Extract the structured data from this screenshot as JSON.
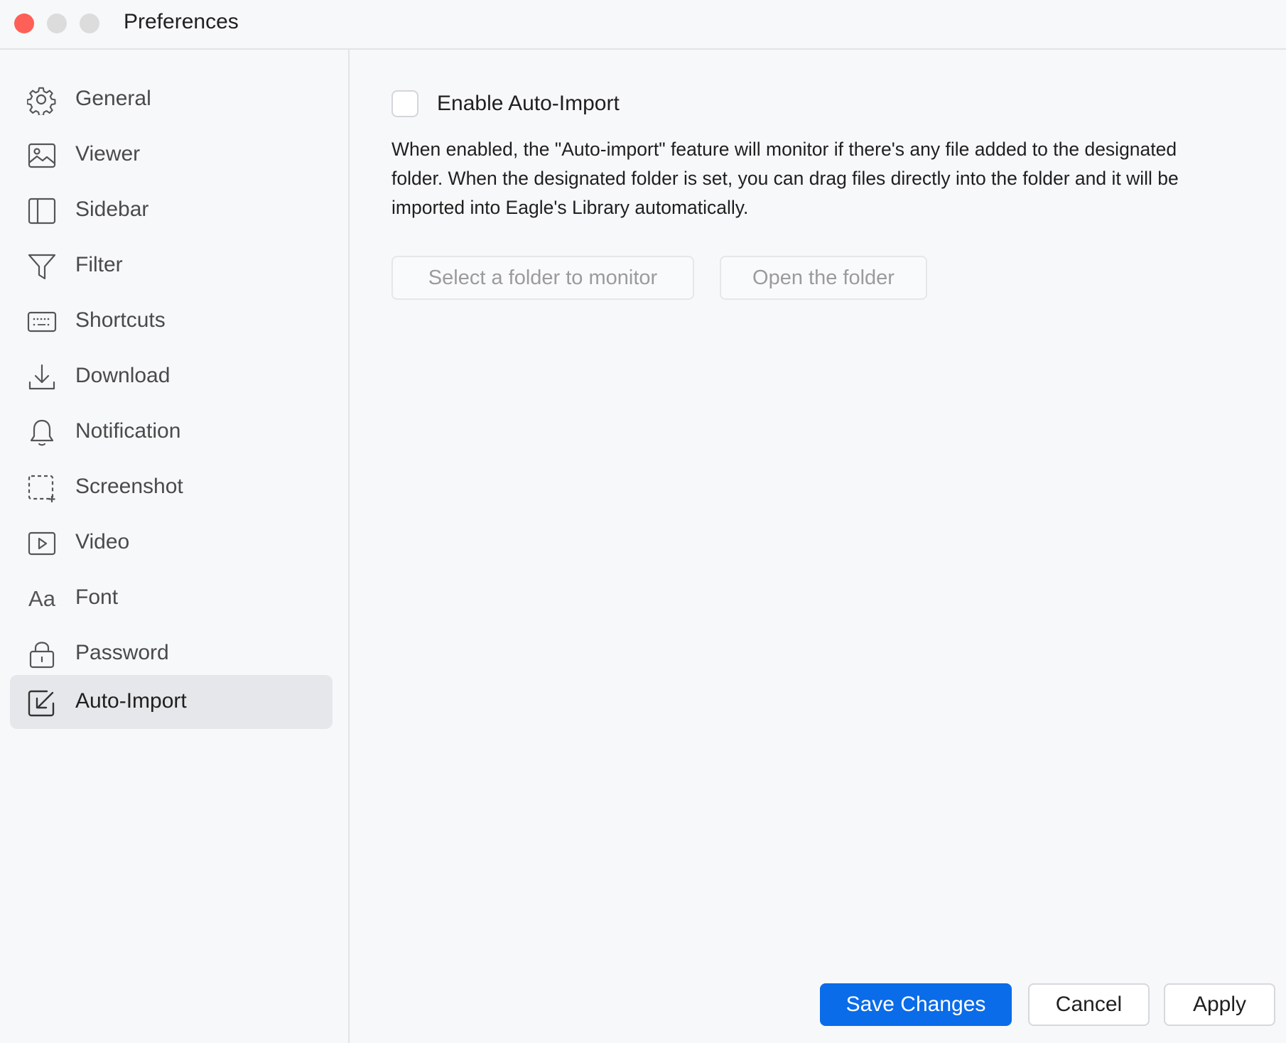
{
  "window": {
    "title": "Preferences",
    "traffic_lights": {
      "close_color": "#fe5f57",
      "inactive_color": "#dcdcdc"
    }
  },
  "sidebar": {
    "items": [
      {
        "label": "General",
        "icon": "gear-icon",
        "active": false
      },
      {
        "label": "Viewer",
        "icon": "image-icon",
        "active": false
      },
      {
        "label": "Sidebar",
        "icon": "sidebar-icon",
        "active": false
      },
      {
        "label": "Filter",
        "icon": "filter-icon",
        "active": false
      },
      {
        "label": "Shortcuts",
        "icon": "keyboard-icon",
        "active": false
      },
      {
        "label": "Download",
        "icon": "download-icon",
        "active": false
      },
      {
        "label": "Notification",
        "icon": "bell-icon",
        "active": false
      },
      {
        "label": "Screenshot",
        "icon": "screenshot-icon",
        "active": false
      },
      {
        "label": "Video",
        "icon": "video-icon",
        "active": false
      },
      {
        "label": "Font",
        "icon": "font-icon",
        "icon_text": "Aa",
        "active": false
      },
      {
        "label": "Password",
        "icon": "lock-icon",
        "active": false
      },
      {
        "label": "Auto-Import",
        "icon": "auto-import-icon",
        "active": true
      }
    ]
  },
  "main": {
    "enable_checkbox": {
      "label": "Enable Auto-Import",
      "checked": false
    },
    "description": "When enabled, the \"Auto-import\" feature will monitor if there's any file added to the designated folder. When the designated folder is set, you can drag files directly into the folder and it will be imported into Eagle's Library automatically.",
    "select_folder_label": "Select a folder to monitor",
    "open_folder_label": "Open the folder"
  },
  "footer": {
    "save_label": "Save Changes",
    "cancel_label": "Cancel",
    "apply_label": "Apply",
    "accent_color": "#0a6ce8"
  }
}
